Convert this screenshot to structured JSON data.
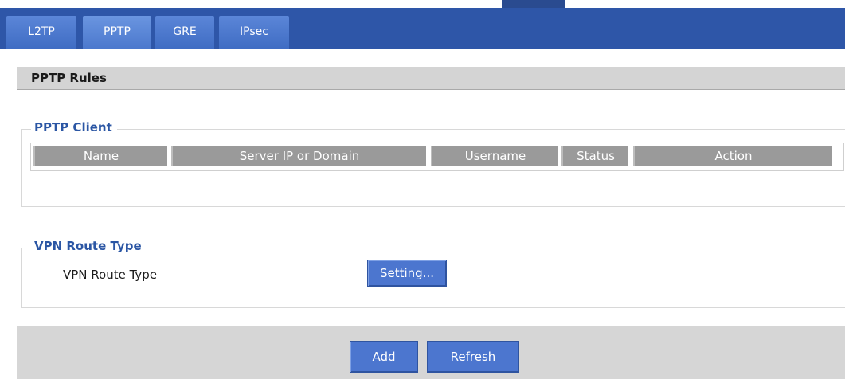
{
  "tabs": [
    {
      "label": "L2TP"
    },
    {
      "label": "PPTP"
    },
    {
      "label": "GRE"
    },
    {
      "label": "IPsec"
    }
  ],
  "section": {
    "title": "PPTP Rules"
  },
  "client": {
    "legend": "PPTP Client",
    "columns": [
      "Name",
      "Server IP or Domain",
      "Username",
      "Status",
      "Action"
    ]
  },
  "route": {
    "legend": "VPN Route Type",
    "label": "VPN Route Type",
    "setting_button": "Setting..."
  },
  "footer": {
    "add_button": "Add",
    "refresh_button": "Refresh"
  },
  "colors": {
    "tabbar": "#2e56a8",
    "tab": "#4b78cd",
    "button": "#4c76cf",
    "legend": "#2b56a4",
    "header_cell": "#9a9a9a"
  }
}
